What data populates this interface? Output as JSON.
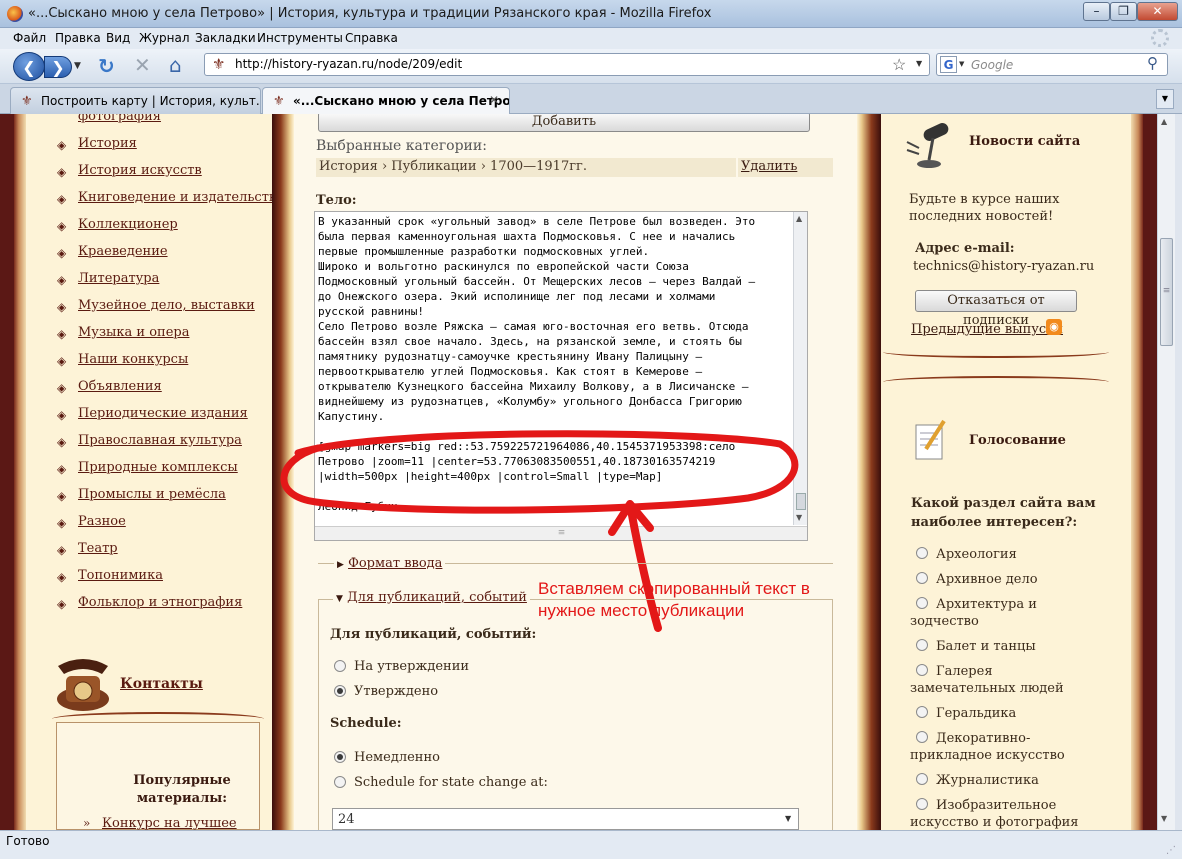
{
  "window": {
    "title": "«...Сыскано мною у села Петрово» | История, культура и традиции Рязанского края - Mozilla Firefox"
  },
  "menu": [
    "Файл",
    "Правка",
    "Вид",
    "Журнал",
    "Закладки",
    "Инструменты",
    "Справка"
  ],
  "nav": {
    "url": "http://history-ryazan.ru/node/209/edit",
    "search_placeholder": "Google"
  },
  "tabs": [
    {
      "label": "Построить карту | История, культ...",
      "active": false
    },
    {
      "label": "«...Сыскано мною у села Петро...",
      "active": true
    }
  ],
  "status": "Готово",
  "left_sidebar": {
    "top_item": "фотография",
    "items": [
      "История",
      "История искусств",
      "Книговедение и издательство",
      "Коллекционер",
      "Краеведение",
      "Литература",
      "Музейное дело, выставки",
      "Музыка и опера",
      "Наши конкурсы",
      "Объявления",
      "Периодические издания",
      "Православная культура",
      "Природные комплексы",
      "Промыслы и ремёсла",
      "Разное",
      "Театр",
      "Топонимика",
      "Фольклор и этнография"
    ],
    "contacts_label": "Контакты",
    "popular_title": "Популярные материалы:",
    "popular_first": "Конкурс на лучшее"
  },
  "main": {
    "add_button": "Добавить",
    "selected_categories_label": "Выбранные категории:",
    "category_path": "История › Публикации › 1700—1917гг.",
    "delete_link": "Удалить",
    "body_label": "Тело:",
    "body_lines": [
      "В указанный срок «угольный завод» в селе Петрове был возведен. Это",
      "была первая каменноугольная шахта Подмосковья. С нее и начались",
      "первые промышленные разработки подмосковных углей.",
      "Широко и вольготно раскинулся по европейской части Союза",
      "Подмосковный угольный бассейн. От Мещерских лесов — через Валдай —",
      "до Онежского озера. Экий исполинище лег под лесами и холмами",
      "русской равнины!",
      "Село Петрово возле Ряжска — самая юго-восточная его ветвь. Отсюда",
      "бассейн взял свое начало. Здесь, на рязанской земле, и стоять бы",
      "памятнику рудознатцу-самоучке крестьянину Ивану Палицыну —",
      "первооткрывателю углей Подмосковья. Как стоят в Кемерове —",
      "открывателю Кузнецкого бассейна Михаилу Волкову, а в Лисичанске —",
      "виднейшему из рудознатцев, «Колумбу» угольного Донбасса Григорию",
      "Капустину.",
      "",
      "[gmap markers=big red::53.759225721964086,40.1545371953398:село",
      "Петрово |zoom=11 |center=53.77063083500551,40.18730163574219",
      "|width=500px |height=400px |control=Small |type=Map]",
      "",
      "Леонид Губин"
    ],
    "annotation": "Вставляем скопированный текст в нужное место публикации",
    "input_format_label": "Формат ввода",
    "fieldset_legend": "Для публикаций, событий",
    "fieldset_title": "Для публикаций, событий:",
    "status_options": [
      {
        "label": "На утверждении",
        "checked": false
      },
      {
        "label": "Утверждено",
        "checked": true
      }
    ],
    "schedule_label": "Schedule:",
    "schedule_options": [
      {
        "label": "Немедленно",
        "checked": true
      },
      {
        "label": "Schedule for state change at:",
        "checked": false
      }
    ],
    "schedule_select_value": "24"
  },
  "right_sidebar": {
    "news_title": "Новости сайта",
    "news_text": "Будьте в курсе наших последних новостей!",
    "email_label": "Адрес e-mail:",
    "email_value": "technics@history-ryazan.ru",
    "unsubscribe_button": "Отказаться от подписки",
    "previous_issues": "Предыдущие выпуски",
    "poll_title": "Голосование",
    "poll_question": "Какой раздел сайта вам наиболее интересен?:",
    "poll_options": [
      "Археология",
      "Архивное дело",
      "Архитектура и зодчество",
      "Балет и танцы",
      "Галерея замечательных людей",
      "Геральдика",
      "Декоративно-прикладное искусство",
      "Журналистика",
      "Изобразительное искусство и фотография"
    ]
  },
  "colors": {
    "accent": "#e31818",
    "link": "#5a1a10",
    "panel": "#fdf3d7",
    "frame": "#5b1815"
  }
}
